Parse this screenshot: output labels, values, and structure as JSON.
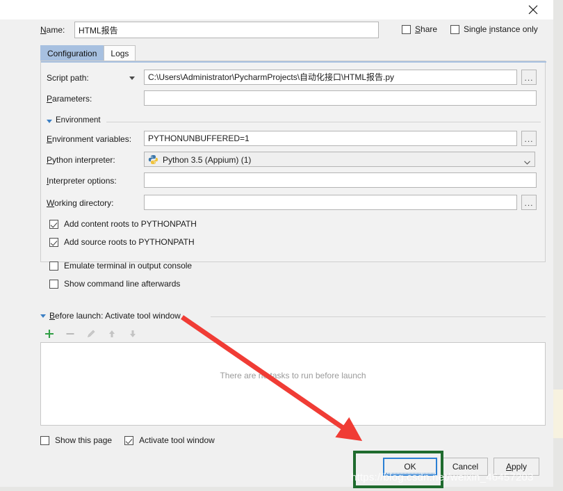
{
  "dialog": {
    "close_icon": "close-icon"
  },
  "name_row": {
    "label": "Name:",
    "label_mnemonic": "N",
    "value": "HTML报告",
    "placeholder": "",
    "share": {
      "label": "Share",
      "mnemonic": "S",
      "checked": false
    },
    "single_instance": {
      "label_pre": "Single ",
      "mnemonic": "i",
      "label_post": "nstance only",
      "checked": false
    }
  },
  "tabs": [
    {
      "label": "Configuration",
      "active": true
    },
    {
      "label": "Logs",
      "active": false
    }
  ],
  "configuration": {
    "script_path": {
      "label": "Script path:",
      "value": "C:\\Users\\Administrator\\PycharmProjects\\自动化接口\\HTML报告.py",
      "browse_label": "...",
      "dropdown_icon": "chevron-down-icon"
    },
    "parameters": {
      "label": "Parameters:",
      "label_mnemonic": "P",
      "value": "",
      "expand_icon": "expand-icon"
    },
    "environment_group": {
      "label": "Environment",
      "collapse_icon": "triangle-down-icon"
    },
    "environment_variables": {
      "label": "Environment variables:",
      "label_mnemonic": "E",
      "value": "PYTHONUNBUFFERED=1",
      "browse_label": "..."
    },
    "python_interpreter": {
      "label": "Python interpreter:",
      "label_mnemonic": "P",
      "value": "Python 3.5 (Appium) (1)",
      "icon": "python-logo-icon",
      "chevron_icon": "chevron-down-icon"
    },
    "interpreter_options": {
      "label": "Interpreter options:",
      "label_mnemonic": "I",
      "value": "",
      "expand_icon": "expand-icon"
    },
    "working_directory": {
      "label": "Working directory:",
      "label_mnemonic": "W",
      "value": "",
      "browse_label": "..."
    },
    "checkboxes": [
      {
        "label": "Add content roots to PYTHONPATH",
        "checked": true
      },
      {
        "label": "Add source roots to PYTHONPATH",
        "checked": true
      },
      {
        "label": "Emulate terminal in output console",
        "checked": false
      },
      {
        "label": "Show command line afterwards",
        "checked": false
      }
    ]
  },
  "before_launch": {
    "header": "Before launch: Activate tool window",
    "header_mnemonic": "B",
    "collapse_icon": "triangle-down-icon",
    "toolbar": [
      {
        "name": "add-button",
        "glyph": "+",
        "enabled": true
      },
      {
        "name": "remove-button",
        "glyph": "−",
        "enabled": false
      },
      {
        "name": "edit-button",
        "glyph": "pencil",
        "enabled": false
      },
      {
        "name": "move-up-button",
        "glyph": "arrow-up",
        "enabled": false
      },
      {
        "name": "move-down-button",
        "glyph": "arrow-down",
        "enabled": false
      }
    ],
    "empty_text": "There are no tasks to run before launch",
    "bottom_checkboxes": [
      {
        "label": "Show this page",
        "checked": false
      },
      {
        "label": "Activate tool window",
        "checked": true
      }
    ]
  },
  "actions": {
    "ok": "OK",
    "cancel": "Cancel",
    "apply": "Apply",
    "apply_mnemonic": "A"
  },
  "annotations": {
    "watermark": "https://blog.csdn.net/weixin_46457203",
    "arrow_color": "#f03c35",
    "highlight_color": "#1f6b2e"
  }
}
